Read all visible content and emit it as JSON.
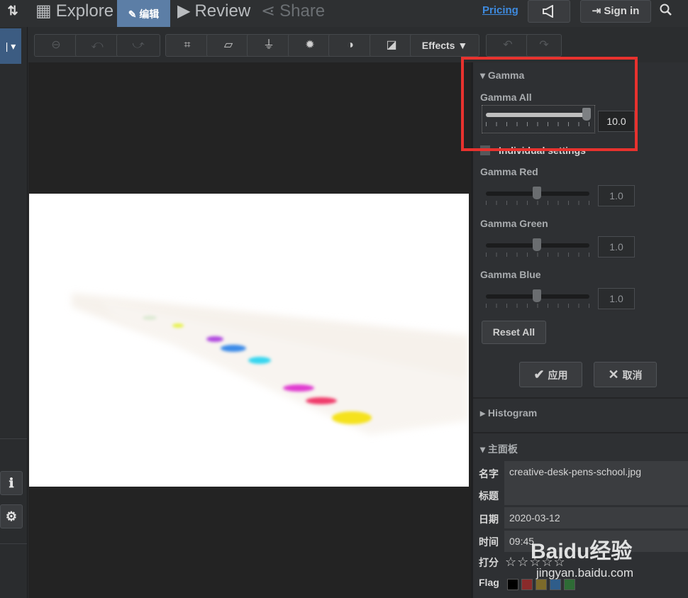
{
  "nav": {
    "explore": "Explore",
    "edit": "编辑",
    "review": "Review",
    "share": "Share",
    "pricing": "Pricing",
    "sign_in": "Sign in"
  },
  "toolbar": {
    "effects": "Effects ▼"
  },
  "gamma": {
    "title": "Gamma",
    "all_label": "Gamma All",
    "all_value": "10.0",
    "individual_label": "Individual settings",
    "red_label": "Gamma Red",
    "red_value": "1.0",
    "green_label": "Gamma Green",
    "green_value": "1.0",
    "blue_label": "Gamma Blue",
    "blue_value": "1.0",
    "reset_label": "Reset All",
    "apply_label": "应用",
    "cancel_label": "取消"
  },
  "histogram": {
    "title": "Histogram"
  },
  "main_panel": {
    "title": "主面板",
    "name_label": "名字",
    "name_value": "creative-desk-pens-school.jpg",
    "caption_label": "标题",
    "caption_value": "",
    "date_label": "日期",
    "date_value": "2020-03-12",
    "time_label": "时间",
    "time_value": "09:45",
    "rating_label": "打分",
    "rating_stars": "☆☆☆☆☆",
    "flag_label": "Flag"
  },
  "flag_colors": [
    "#000000",
    "#8a2b2b",
    "#7d6a2a",
    "#2f5d8a",
    "#2e6b35"
  ],
  "watermark": {
    "brand": "Baidu经验",
    "url": "jingyan.baidu.com"
  }
}
